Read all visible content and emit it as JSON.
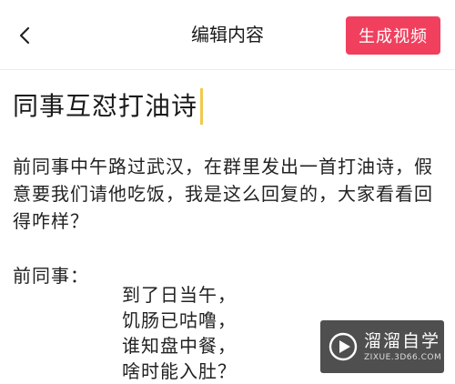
{
  "header": {
    "back_icon": "chevron-left-icon",
    "title": "编辑内容",
    "generate_button_label": "生成视频"
  },
  "editor": {
    "title": "同事互怼打油诗",
    "paragraphs": [
      "前同事中午路过武汉，在群里发出一首打油诗，假意要我们请他吃饭，我是这么回复的，大家看看回得咋样？",
      "前同事："
    ],
    "poem_lines": [
      "到了日当午，",
      "饥肠已咕噜，",
      "谁知盘中餐，",
      "啥时能入肚？"
    ]
  },
  "watermark": {
    "logo_icon": "play-logo-icon",
    "text": "溜溜自学",
    "subtext": "ZIXUE.3D66.COM"
  },
  "colors": {
    "accent": "#f0405e",
    "caret": "#f2c94c",
    "divider": "#ececec",
    "text": "#222222"
  }
}
